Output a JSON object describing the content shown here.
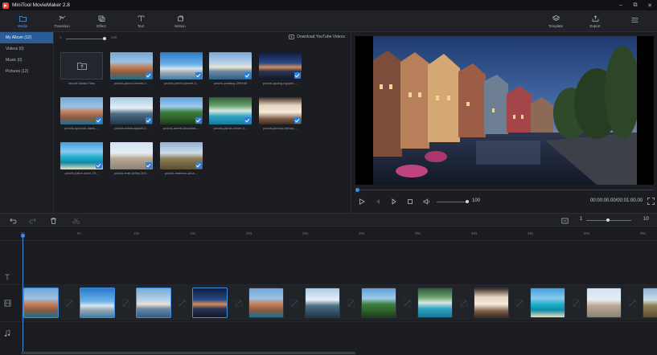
{
  "app": {
    "title": "MiniTool MovieMaker 2.8"
  },
  "window_controls": [
    "–",
    "⧉",
    "✕"
  ],
  "toolbar": {
    "items": [
      {
        "label": "Media",
        "icon": "media-folder-icon",
        "active": true
      },
      {
        "label": "Transition",
        "icon": "transition-icon",
        "active": false
      },
      {
        "label": "Effect",
        "icon": "effect-icon",
        "active": false
      },
      {
        "label": "Text",
        "icon": "text-icon",
        "active": false
      },
      {
        "label": "Motion",
        "icon": "motion-icon",
        "active": false
      }
    ],
    "template_label": "Template",
    "export_label": "Export"
  },
  "albums": [
    {
      "label": "My Album  (12)",
      "active": true
    },
    {
      "label": "Videos  (0)",
      "active": false
    },
    {
      "label": "Music  (0)",
      "active": false
    },
    {
      "label": "Pictures  (12)",
      "active": false
    }
  ],
  "media": {
    "zoom_min": "1",
    "zoom_max": "100",
    "zoom_level": 1.0,
    "download_link": "Download YouTube Videos",
    "import_label": "Import Media Files",
    "items": [
      {
        "caption": "pexels-pierre-blaché-2...",
        "scene": "coast",
        "checked": true
      },
      {
        "caption": "pexels-pierre-blaché-3...",
        "scene": "palace",
        "checked": true
      },
      {
        "caption": "pexels-pixabay-258106",
        "scene": "lake",
        "checked": true
      },
      {
        "caption": "pexels-quang-nguyen-...",
        "scene": "night",
        "checked": true
      },
      {
        "caption": "pexels-spencer-davis-...",
        "scene": "coast",
        "checked": true
      },
      {
        "caption": "pexels-tobias-bjørkli-2...",
        "scene": "glacier",
        "checked": true
      },
      {
        "caption": "pexels-archie-binamira-...",
        "scene": "valley",
        "checked": true
      },
      {
        "caption": "pexels-jaime-reimer-2...",
        "scene": "pool",
        "checked": true
      },
      {
        "caption": "pexels-jeremy-bishop-...",
        "scene": "cabin",
        "checked": true
      },
      {
        "caption": "pexels-julius-silver-75...",
        "scene": "island",
        "checked": true
      },
      {
        "caption": "pexels-leah-kelley-393...",
        "scene": "reading",
        "checked": true
      },
      {
        "caption": "pexels-matteus-silva-...",
        "scene": "steppe",
        "checked": true
      }
    ]
  },
  "player": {
    "volume": "100",
    "volume_level": 1.0,
    "timecode": "00:00:00.00/00:01:00.00",
    "progress": 0.0
  },
  "timeline": {
    "zoom_min": "1",
    "zoom_max": "10",
    "zoom_level": 0.45,
    "ticks": [
      "0s",
      "5s",
      "10s",
      "15s",
      "20s",
      "25s",
      "30s",
      "35s",
      "40s",
      "45s",
      "50s",
      "55s"
    ],
    "clips": [
      {
        "scene": "coast",
        "selected": true
      },
      {
        "scene": "palace",
        "selected": true
      },
      {
        "scene": "lake",
        "selected": true
      },
      {
        "scene": "night",
        "selected": true
      },
      {
        "scene": "coast",
        "selected": false
      },
      {
        "scene": "glacier",
        "selected": false
      },
      {
        "scene": "valley",
        "selected": false
      },
      {
        "scene": "pool",
        "selected": false
      },
      {
        "scene": "cabin",
        "selected": false
      },
      {
        "scene": "island",
        "selected": false
      },
      {
        "scene": "reading",
        "selected": false
      },
      {
        "scene": "steppe",
        "selected": false
      }
    ]
  },
  "colors": {
    "accent": "#3f8de0",
    "active_album": "#2a5d97",
    "background": "#1b1d22"
  }
}
